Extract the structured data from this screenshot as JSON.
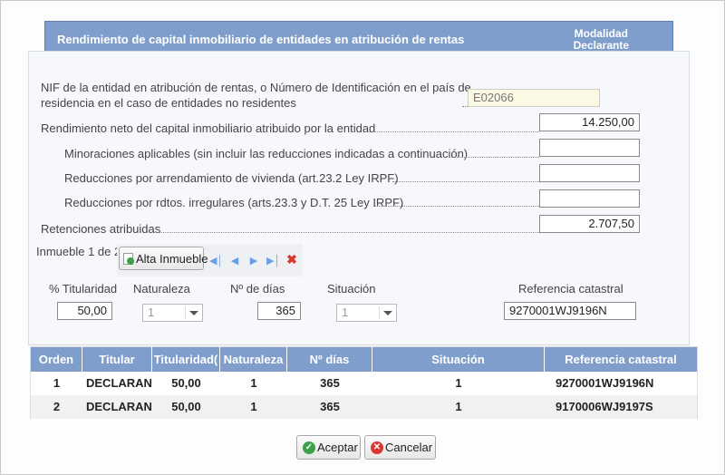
{
  "header": {
    "title": "Rendimiento de capital inmobiliario de entidades en atribución de rentas",
    "modality_line1": "Modalidad",
    "modality_line2": "Declarante"
  },
  "form": {
    "nif_label_line1": "NIF de la entidad en atribución de rentas, o Número de Identificación en el país de",
    "nif_label_line2": "residencia en el caso de entidades no residentes",
    "nif_value": "E02066",
    "rendimiento_label": "Rendimiento neto del capital inmobiliario atribuido por la entidad",
    "rendimiento_value": "14.250,00",
    "minoraciones_label": "Minoraciones aplicables (sin incluir las reducciones indicadas a continuación)",
    "minoraciones_value": "",
    "reducciones_vivienda_label": "Reducciones por arrendamiento de vivienda (art.23.2 Ley IRPF)",
    "reducciones_vivienda_value": "",
    "reducciones_irregulares_label": "Reducciones por rdtos. irregulares (arts.23.3 y D.T. 25 Ley IRPF)",
    "reducciones_irregulares_value": "",
    "retenciones_label": "Retenciones atribuidas",
    "retenciones_value": "2.707,50"
  },
  "inmueble": {
    "counter": "Inmueble 1 de 2",
    "add_button": "Alta Inmueble",
    "fields": {
      "titularidad_label": "% Titularidad",
      "titularidad_value": "50,00",
      "naturaleza_label": "Naturaleza",
      "naturaleza_value": "1",
      "dias_label": "Nº de días",
      "dias_value": "365",
      "situacion_label": "Situación",
      "situacion_value": "1",
      "referencia_label": "Referencia catastral",
      "referencia_value": "9270001WJ9196N"
    }
  },
  "table": {
    "columns": [
      "Orden",
      "Titular",
      "Titularidad(",
      "Naturaleza",
      "Nº días",
      "Situación",
      "Referencia catastral"
    ],
    "rows": [
      [
        "1",
        "DECLARANTE",
        "50,00",
        "1",
        "365",
        "1",
        "9270001WJ9196N"
      ],
      [
        "2",
        "DECLARANTE",
        "50,00",
        "1",
        "365",
        "1",
        "9170006WJ9197S"
      ]
    ]
  },
  "buttons": {
    "accept": "Aceptar",
    "cancel": "Cancelar"
  }
}
